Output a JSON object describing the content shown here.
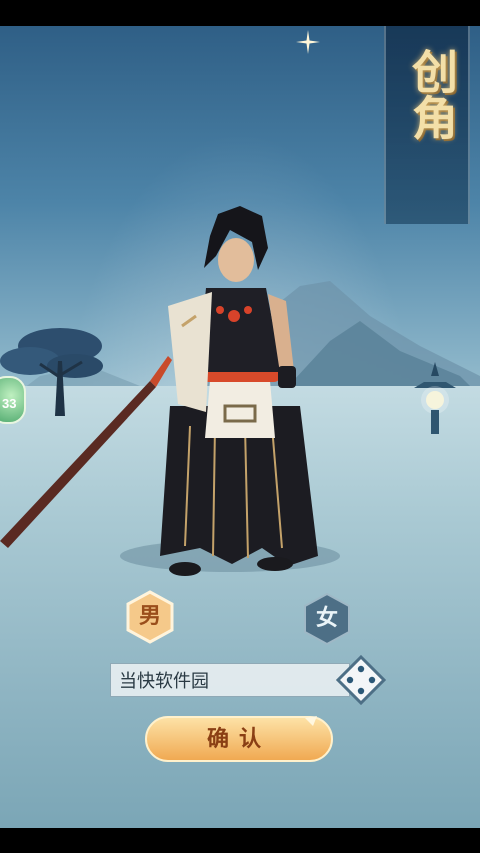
{
  "screen": {
    "title": "创角"
  },
  "side_badge": {
    "value": "33"
  },
  "gender": {
    "male_label": "男",
    "female_label": "女",
    "selected": "男"
  },
  "name_field": {
    "value": "当快软件园"
  },
  "confirm": {
    "label": "确认"
  },
  "colors": {
    "accent_gold": "#f3dfa8",
    "button_orange": "#f2b25a",
    "male_hex": "#f5c98a",
    "female_hex": "#4d6f86"
  },
  "icons": [
    "sparkle-icon",
    "dice-icon",
    "tree-icon",
    "lantern-icon"
  ]
}
